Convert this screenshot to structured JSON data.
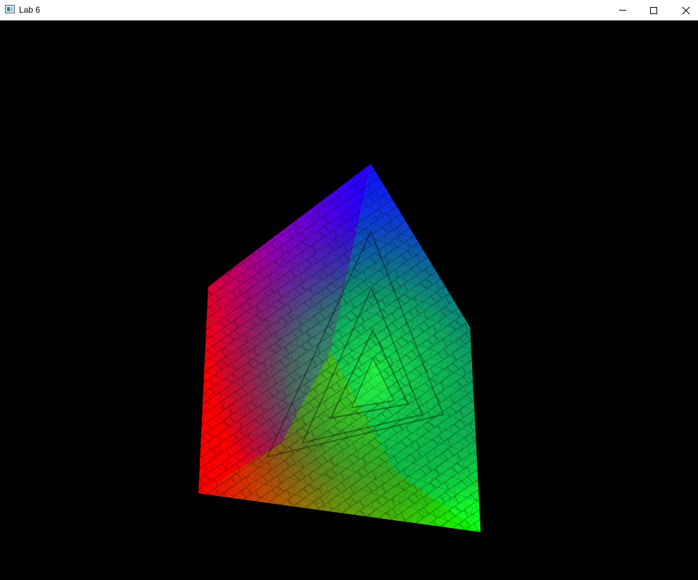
{
  "window": {
    "title": "Lab 6",
    "icon": "app-window-icon",
    "controls": {
      "minimize": "minimize-icon",
      "maximize": "maximize-icon",
      "close": "close-icon"
    }
  },
  "scene": {
    "background": "#000000",
    "object": "textured-cube",
    "face_colors": {
      "left": "#ff0000",
      "top": "#0000ff",
      "bottom": "#00ff00"
    }
  }
}
